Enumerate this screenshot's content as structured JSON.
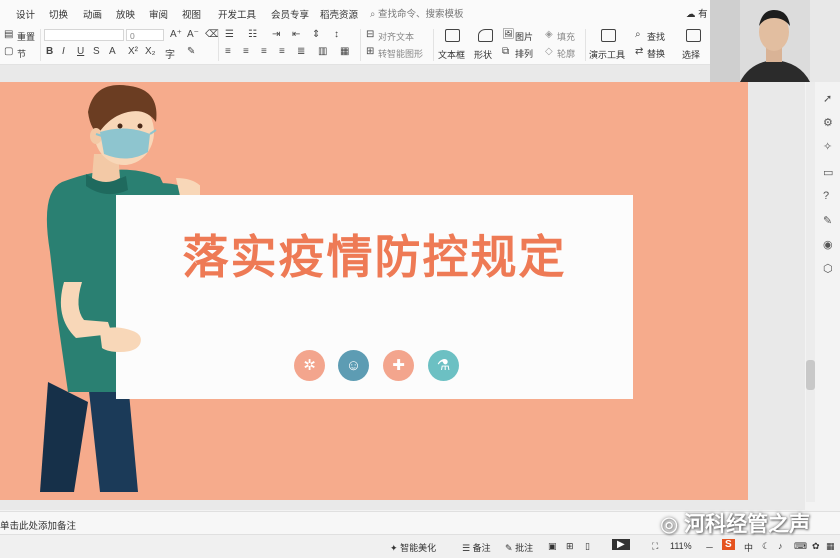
{
  "menu": {
    "items": [
      "设计",
      "切换",
      "动画",
      "放映",
      "审阅",
      "视图",
      "开发工具",
      "会员专享",
      "稻壳资源"
    ],
    "search_placeholder": "查找命令、搜索模板",
    "cloud_label": "有"
  },
  "toolbar": {
    "reset_label": "重置",
    "section_label": "节",
    "font_size_value": "0",
    "text_box_label": "文本框",
    "shape_label": "形状",
    "picture_label": "图片",
    "fill_label": "填充",
    "arrange_label": "排列",
    "outline_label": "轮廓",
    "present_tools_label": "演示工具",
    "find_label": "查找",
    "replace_label": "替换",
    "select_label": "选择",
    "align_text_label": "对齐文本",
    "smartart_label": "转智能图形",
    "bold_label": "B",
    "italic_label": "I",
    "underline_label": "U",
    "strike_label": "S",
    "font_color_label": "A"
  },
  "slide": {
    "title": "落实疫情防控规定",
    "background_color": "#f6ab8c",
    "title_color": "#ee7a55",
    "icons": [
      {
        "name": "virus-icon",
        "color": "#f3a58d"
      },
      {
        "name": "person-icon",
        "color": "#5d9cb3"
      },
      {
        "name": "medical-kit-icon",
        "color": "#f3a58d"
      },
      {
        "name": "flask-icon",
        "color": "#6cc0c3"
      }
    ]
  },
  "notes": {
    "placeholder": "单击此处添加备注"
  },
  "status": {
    "smart_beautify": "智能美化",
    "notes": "备注",
    "comments": "批注",
    "zoom": "111%",
    "ime_label": "中"
  },
  "watermark": {
    "text": "河科经管之声"
  }
}
